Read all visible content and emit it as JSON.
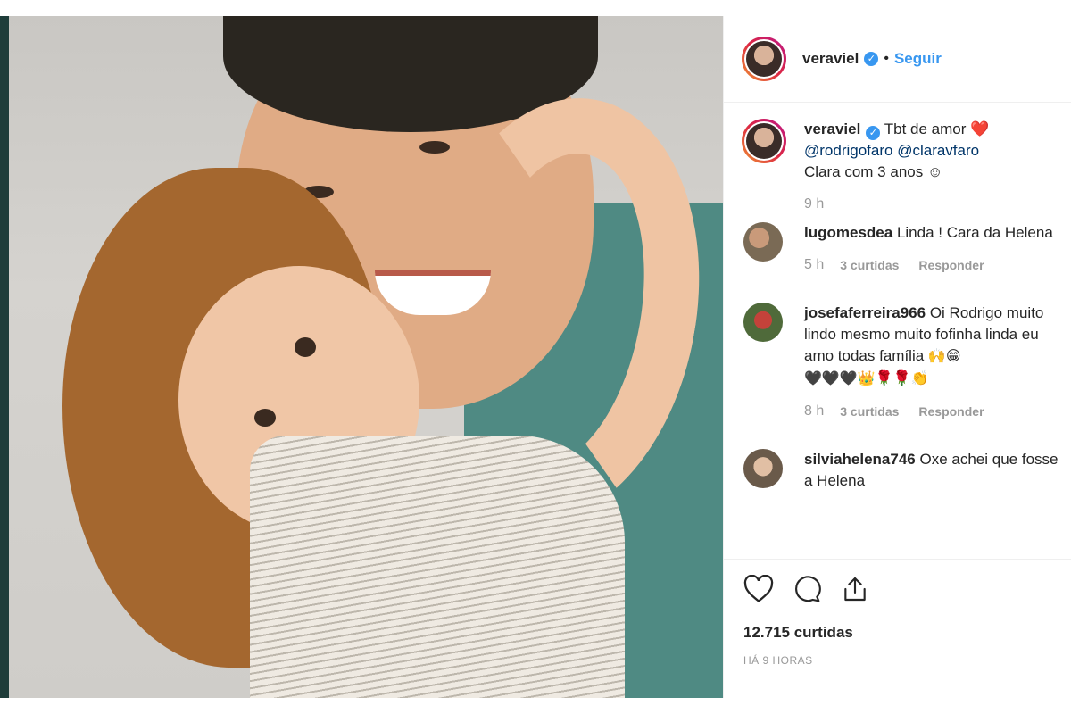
{
  "post": {
    "username": "veraviel",
    "follow_label": "Seguir",
    "separator": "•",
    "verified_mark": "✓"
  },
  "caption": {
    "username": "veraviel",
    "text": "Tbt de amor",
    "heart_emoji": "❤️",
    "mention1": "@rodrigofaro",
    "mention2": "@claravfaro",
    "line2": "Clara com 3 anos ☺",
    "time": "9 h"
  },
  "comments": [
    {
      "username": "lugomesdea",
      "text": "Linda ! Cara da Helena",
      "time": "5 h",
      "likes": "3 curtidas",
      "reply": "Responder"
    },
    {
      "username": "josefaferreira966",
      "text": "Oi Rodrigo muito lindo mesmo muito fofinha linda eu amo todas família",
      "emojis1": "🙌😁",
      "emojis2": "🖤🖤🖤👑🌹🌹👏",
      "time": "8 h",
      "likes": "3 curtidas",
      "reply": "Responder"
    },
    {
      "username": "silviahelena746",
      "text": "Oxe achei que fosse a Helena"
    }
  ],
  "footer": {
    "likes_total": "12.715 curtidas",
    "posted": "HÁ 9 HORAS"
  },
  "icons": {
    "like": "heart-icon",
    "comment": "comment-icon",
    "share": "share-icon"
  },
  "colors": {
    "link": "#3897f0",
    "muted": "#999999",
    "border": "#efefef"
  }
}
